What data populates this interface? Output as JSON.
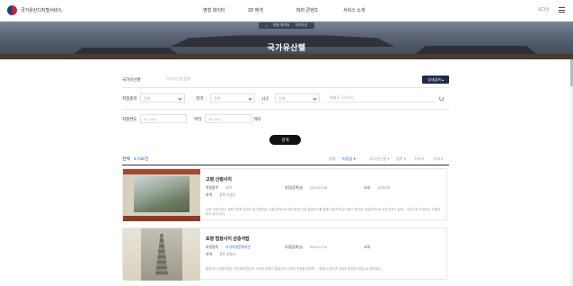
{
  "header": {
    "logo_text": "국가유산디지털서비스",
    "nav": [
      "영형 데이터",
      "3D 에셋",
      "테마 콘텐츠",
      "서비스 소개"
    ],
    "util": "로그인"
  },
  "hero": {
    "breadcrumb": [
      "⌂",
      "유형 데이터",
      "국가유산"
    ],
    "title": "국가유산텔"
  },
  "search": {
    "name_label": "국가유산명",
    "name_placeholder": "국가유산명 검색",
    "detail_button": "상세검색 ▴",
    "category_label": "지정종목",
    "category_value": "전체",
    "region_label": "지역",
    "region_value": "전체",
    "city_label": "시군",
    "city_value": "전체",
    "address_placeholder": "예제로 국가유산",
    "date_label": "지정연도",
    "date_start_placeholder": "00. 00.0",
    "date_sep": "부터",
    "date_end_placeholder": "00. 00.0",
    "date_end_label": "까지",
    "submit": "검색"
  },
  "results": {
    "total_label": "전체",
    "total_count": "6,736건",
    "sorts": [
      "정렬",
      "지정일 ▾",
      "국가유산명 ▾",
      "종목 ▾",
      "지역 ▾",
      "시대 ▾"
    ]
  },
  "cards": [
    {
      "title": "고령 신령사지",
      "kv": [
        {
          "k": "지정종목",
          "v": "사적"
        },
        {
          "k": "지정(등록)일",
          "v": "2023.12.28"
        },
        {
          "k": "시대",
          "v": "고려시대"
        },
        {
          "k": "지역",
          "v": "경북 고령군"
        }
      ],
      "desc": "고령 신령사지는 문헌기록과 유적이 잘 전해지는 사찰 유적으로 제12호와 관련 발굴조사를 통해 건물지와 유구들이 확인된 사찰유적으로 보존가치가 높음... 금당지로 추정되는 건물지 등이 남아 있다."
    },
    {
      "title": "포항 법광사지 삼층석탑",
      "kv": [
        {
          "k": "지정종목",
          "v": "국가지정문화유산",
          "link": true
        },
        {
          "k": "지정(등록)일",
          "v": "2023.12.15"
        },
        {
          "k": "시대",
          "v": ""
        },
        {
          "k": "지역",
          "v": "경북 포항시"
        }
      ],
      "desc": "법광사지 삼층석탑은 기단부와 탑신부 구성과 조형이 통일신라 석탑의 전형을 따르며 ... 법광사 창건과 관련된 중요한 석탑으로 평가된다."
    }
  ]
}
